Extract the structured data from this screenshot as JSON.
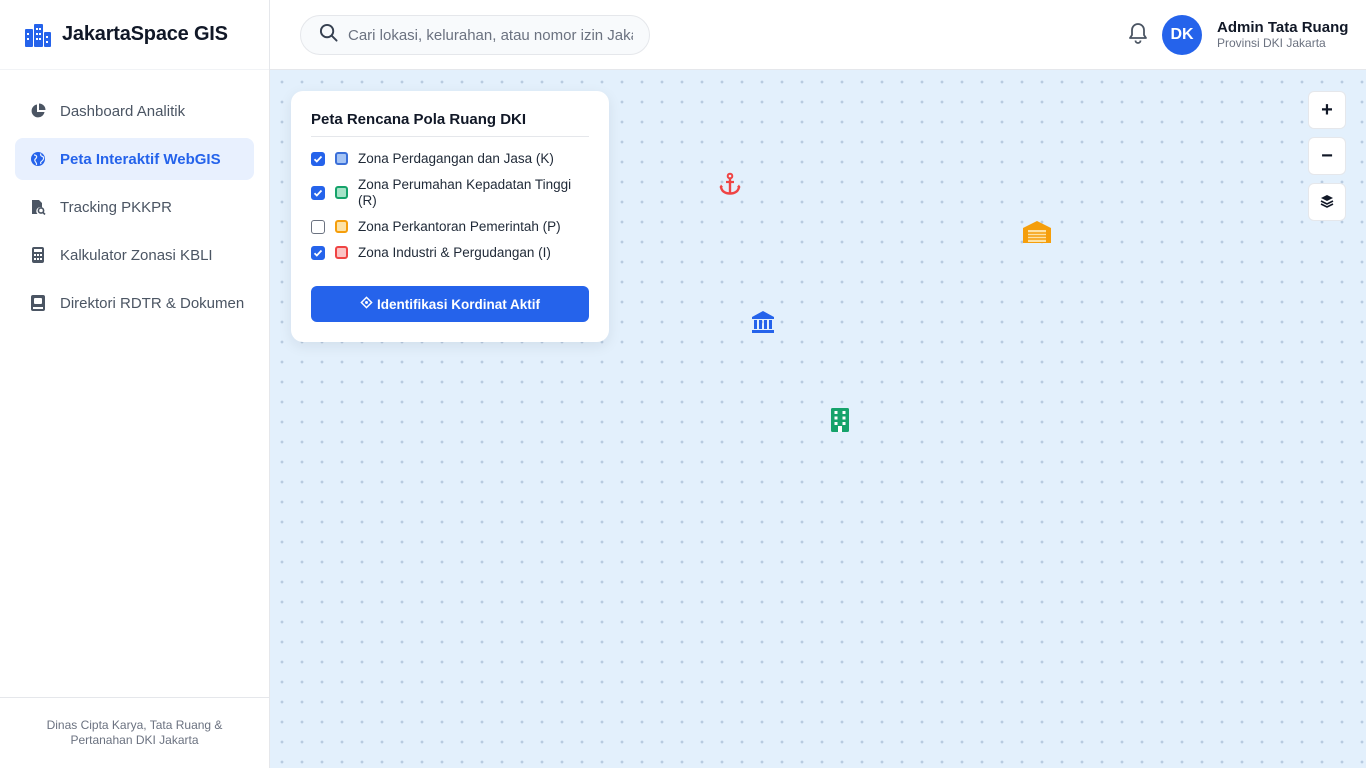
{
  "app": {
    "title": "JakartaSpace GIS"
  },
  "colors": {
    "accent": "#2563eb",
    "map_bg": "#e3f0fc"
  },
  "sidebar": {
    "items": [
      {
        "label": "Dashboard Analitik",
        "icon": "pie-chart-icon",
        "active": false
      },
      {
        "label": "Peta Interaktif WebGIS",
        "icon": "globe-icon",
        "active": true
      },
      {
        "label": "Tracking PKKPR",
        "icon": "file-search-icon",
        "active": false
      },
      {
        "label": "Kalkulator Zonasi KBLI",
        "icon": "calculator-icon",
        "active": false
      },
      {
        "label": "Direktori RDTR & Dokumen",
        "icon": "book-icon",
        "active": false
      }
    ],
    "footer": "Dinas Cipta Karya, Tata Ruang & Pertanahan DKI Jakarta"
  },
  "search": {
    "placeholder": "Cari lokasi, kelurahan, atau nomor izin Jakarta..."
  },
  "header": {
    "notification_icon": "bell-icon",
    "avatar_initials": "DK",
    "user_name": "Admin Tata Ruang",
    "user_role": "Provinsi DKI Jakarta"
  },
  "panel": {
    "title": "Peta Rencana Pola Ruang DKI",
    "layers": [
      {
        "label": "Zona Perdagangan dan Jasa (K)",
        "checked": true,
        "fill": "#a5c4f5",
        "border": "#3b6fd8"
      },
      {
        "label": "Zona Perumahan Kepadatan Tinggi (R)",
        "checked": true,
        "fill": "#a7e3c8",
        "border": "#16a36b"
      },
      {
        "label": "Zona Perkantoran Pemerintah (P)",
        "checked": false,
        "fill": "#fde2a6",
        "border": "#f59e0b"
      },
      {
        "label": "Zona Industri & Pergudangan (I)",
        "checked": true,
        "fill": "#fbc4c4",
        "border": "#ef4444"
      }
    ],
    "button_label": "Identifikasi Kordinat Aktif"
  },
  "map_controls": {
    "zoom_in": "+",
    "zoom_out": "−",
    "layers_icon": "layers-icon"
  },
  "markers": [
    {
      "icon": "anchor-icon",
      "color": "#ef4444"
    },
    {
      "icon": "warehouse-icon",
      "color": "#f59e0b"
    },
    {
      "icon": "government-building-icon",
      "color": "#2563eb"
    },
    {
      "icon": "office-building-icon",
      "color": "#16a36b"
    }
  ]
}
